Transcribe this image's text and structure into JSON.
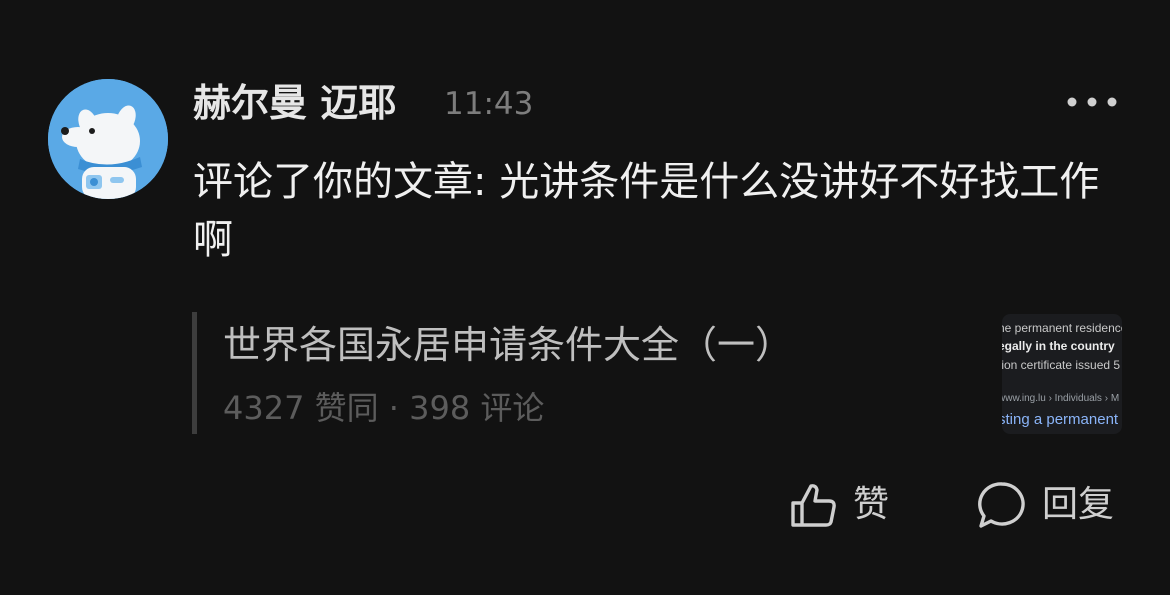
{
  "comment": {
    "username": "赫尔曼 迈耶",
    "time": "11:43",
    "text": "评论了你的文章: 光讲条件是什么没讲好不好找工作啊"
  },
  "quoted_article": {
    "title": "世界各国永居申请条件大全（一）",
    "stats": "4327 赞同 · 398 评论",
    "thumbnail_lines": [
      "he permanent residence",
      "egally in the country",
      "tion certificate issued 5",
      "www.ing.lu › Individuals › M",
      "sting a permanent"
    ]
  },
  "actions": {
    "like_label": "赞",
    "reply_label": "回复"
  },
  "icons": {
    "more": "more-horizontal-icon",
    "like": "thumbs-up-icon",
    "reply": "speech-bubble-icon"
  },
  "colors": {
    "background": "#121212",
    "avatar_bg": "#5aa9e6",
    "link": "#8ab4f8"
  }
}
